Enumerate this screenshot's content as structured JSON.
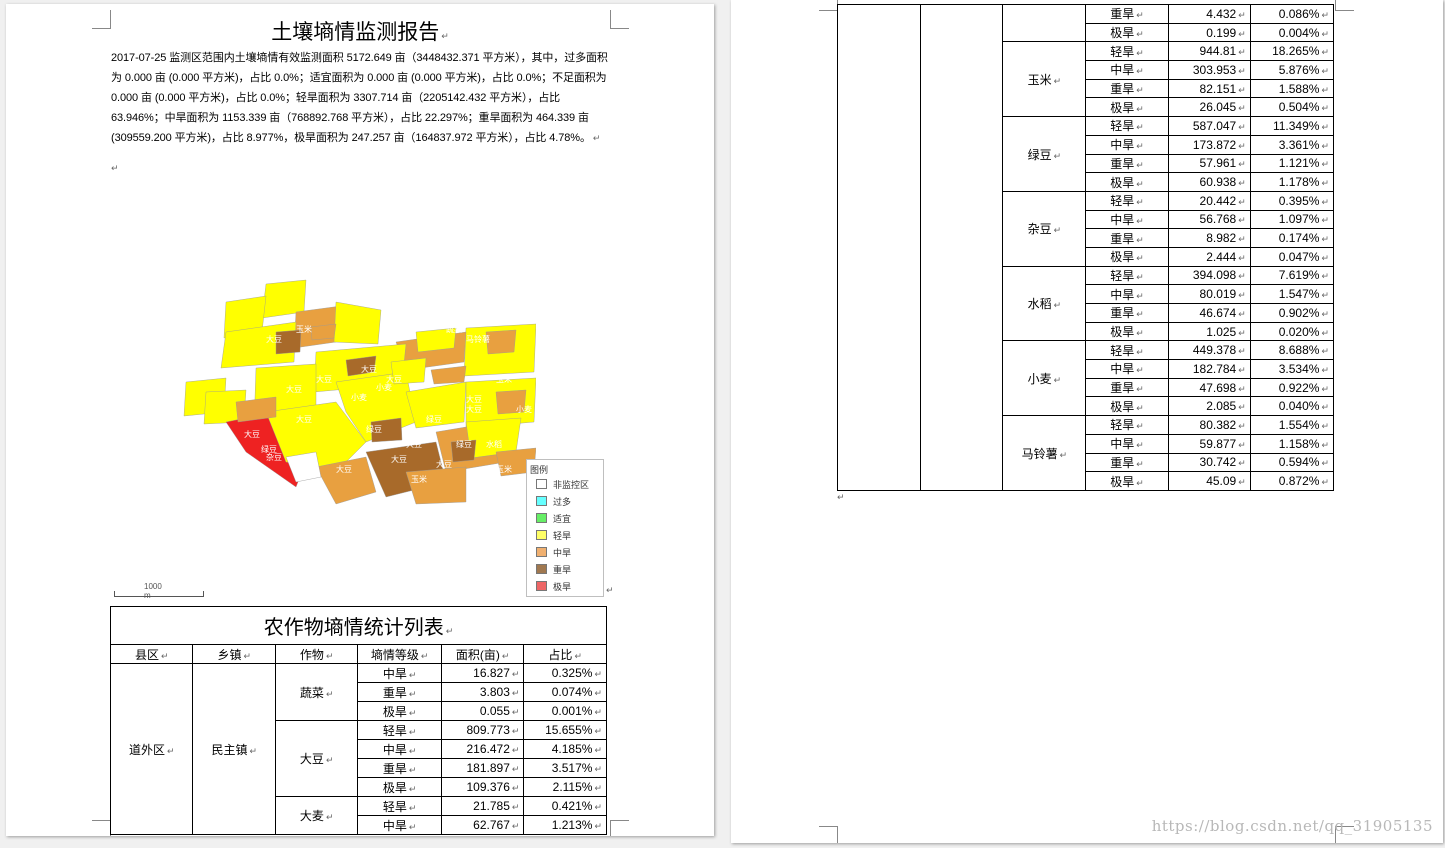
{
  "report": {
    "title": "土壤墒情监测报告",
    "paragraph": "2017-07-25 监测区范围内土壤墒情有效监测面积 5172.649 亩（3448432.371 平方米），其中，过多面积为 0.000 亩 (0.000 平方米)，占比 0.0%；适宜面积为 0.000 亩 (0.000 平方米)，占比 0.0%；不足面积为 0.000 亩 (0.000 平方米)，占比 0.0%；轻旱面积为 3307.714 亩（2205142.432 平方米），占比 63.946%；中旱面积为 1153.339 亩（768892.768 平方米），占比 22.297%；重旱面积为 464.339 亩 (309559.200 平方米)，占比 8.977%，极旱面积为 247.257 亩（164837.972 平方米），占比 4.78%。"
  },
  "legend": {
    "title": "图例",
    "items": [
      {
        "label": "非监控区",
        "color": "#ffffff"
      },
      {
        "label": "过多",
        "color": "#66ffff"
      },
      {
        "label": "适宜",
        "color": "#66ee66"
      },
      {
        "label": "轻旱",
        "color": "#ffff66"
      },
      {
        "label": "中旱",
        "color": "#f0b070"
      },
      {
        "label": "重旱",
        "color": "#a07850"
      },
      {
        "label": "极旱",
        "color": "#ee6666"
      }
    ]
  },
  "scale_label": "1000 m",
  "map_labels": [
    "大豆",
    "小麦",
    "大豆",
    "小麦",
    "绿豆",
    "杂豆",
    "大豆",
    "大豆",
    "绿豆",
    "大豆",
    "玉米",
    "大豆",
    "绿豆",
    "大豆",
    "玉米",
    "玉米",
    "大豆",
    "大豆",
    "蔬菜",
    "马铃薯",
    "绿豆",
    "大豆",
    "大豆",
    "玉米",
    "大豆",
    "水稻",
    "小麦",
    "大豆"
  ],
  "table": {
    "caption": "农作物墒情统计列表",
    "headers": [
      "县区",
      "乡镇",
      "作物",
      "墒情等级",
      "面积(亩)",
      "占比"
    ],
    "district": "道外区",
    "town": "民主镇",
    "page1_groups": [
      {
        "crop": "蔬菜",
        "rows": [
          [
            "中旱",
            "16.827",
            "0.325%"
          ],
          [
            "重旱",
            "3.803",
            "0.074%"
          ],
          [
            "极旱",
            "0.055",
            "0.001%"
          ]
        ]
      },
      {
        "crop": "大豆",
        "rows": [
          [
            "轻旱",
            "809.773",
            "15.655%"
          ],
          [
            "中旱",
            "216.472",
            "4.185%"
          ],
          [
            "重旱",
            "181.897",
            "3.517%"
          ],
          [
            "极旱",
            "109.376",
            "2.115%"
          ]
        ]
      },
      {
        "crop": "大麦",
        "rows": [
          [
            "轻旱",
            "21.785",
            "0.421%"
          ],
          [
            "中旱",
            "62.767",
            "1.213%"
          ]
        ]
      }
    ],
    "page2_top_rows": [
      [
        "重旱",
        "4.432",
        "0.086%"
      ],
      [
        "极旱",
        "0.199",
        "0.004%"
      ]
    ],
    "page2_groups": [
      {
        "crop": "玉米",
        "rows": [
          [
            "轻旱",
            "944.81",
            "18.265%"
          ],
          [
            "中旱",
            "303.953",
            "5.876%"
          ],
          [
            "重旱",
            "82.151",
            "1.588%"
          ],
          [
            "极旱",
            "26.045",
            "0.504%"
          ]
        ]
      },
      {
        "crop": "绿豆",
        "rows": [
          [
            "轻旱",
            "587.047",
            "11.349%"
          ],
          [
            "中旱",
            "173.872",
            "3.361%"
          ],
          [
            "重旱",
            "57.961",
            "1.121%"
          ],
          [
            "极旱",
            "60.938",
            "1.178%"
          ]
        ]
      },
      {
        "crop": "杂豆",
        "rows": [
          [
            "轻旱",
            "20.442",
            "0.395%"
          ],
          [
            "中旱",
            "56.768",
            "1.097%"
          ],
          [
            "重旱",
            "8.982",
            "0.174%"
          ],
          [
            "极旱",
            "2.444",
            "0.047%"
          ]
        ]
      },
      {
        "crop": "水稻",
        "rows": [
          [
            "轻旱",
            "394.098",
            "7.619%"
          ],
          [
            "中旱",
            "80.019",
            "1.547%"
          ],
          [
            "重旱",
            "46.674",
            "0.902%"
          ],
          [
            "极旱",
            "1.025",
            "0.020%"
          ]
        ]
      },
      {
        "crop": "小麦",
        "rows": [
          [
            "轻旱",
            "449.378",
            "8.688%"
          ],
          [
            "中旱",
            "182.784",
            "3.534%"
          ],
          [
            "重旱",
            "47.698",
            "0.922%"
          ],
          [
            "极旱",
            "2.085",
            "0.040%"
          ]
        ]
      },
      {
        "crop": "马铃薯",
        "rows": [
          [
            "轻旱",
            "80.382",
            "1.554%"
          ],
          [
            "中旱",
            "59.877",
            "1.158%"
          ],
          [
            "重旱",
            "30.742",
            "0.594%"
          ],
          [
            "极旱",
            "45.09",
            "0.872%"
          ]
        ]
      }
    ]
  },
  "watermark": "https://blog.csdn.net/qq_31905135",
  "return_mark": "↵"
}
